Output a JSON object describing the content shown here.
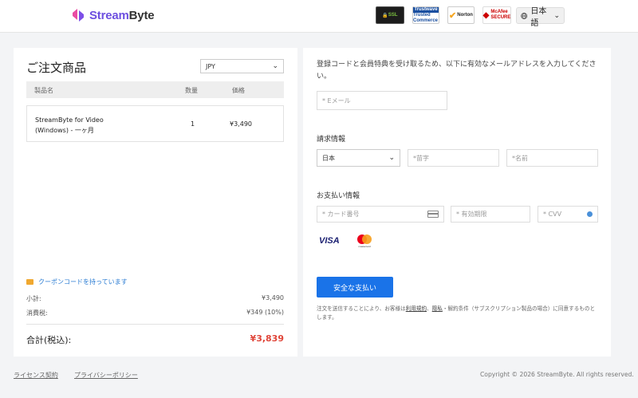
{
  "header": {
    "brand": {
      "prefix": "Stream",
      "suffix": "Byte"
    },
    "badges": {
      "ssl": "SSL",
      "trust_top": "Trustwave",
      "trust_bottom": "Trusted Commerce",
      "norton": "Norton",
      "mcafee": "McAfee SECURE"
    },
    "language": "日本語"
  },
  "order": {
    "title": "ご注文商品",
    "currency": "JPY",
    "columns": {
      "product": "製品名",
      "quantity": "数量",
      "price": "価格"
    },
    "item": {
      "name": "StreamByte for Video (Windows) - 一ヶ月",
      "quantity": "1",
      "price": "¥3,490"
    },
    "coupon_link": "クーポンコードを持っています",
    "subtotal_label": "小計:",
    "subtotal_value": "¥3,490",
    "tax_label": "消費税:",
    "tax_value": "¥349 (10%)",
    "total_label": "合計(税込):",
    "total_value": "¥3,839"
  },
  "form": {
    "intro": "登録コードと会員特典を受け取るため、以下に有効なメールアドレスを入力してください。",
    "email_placeholder": "* Eメール",
    "billing_label": "請求情報",
    "country": "日本",
    "surname_placeholder": "*苗字",
    "given_name_placeholder": "*名前",
    "payment_label": "お支払い情報",
    "card_number_placeholder": "* カード番号",
    "expiry_placeholder": "* 有効期限",
    "cvv_placeholder": "* CVV",
    "visa": "VISA",
    "mastercard": "mastercard",
    "pay_button": "安全な支払い",
    "terms_before": "注文を送信することにより、お客様は",
    "terms_link1": "利用規約",
    "terms_sep": "、",
    "terms_link2": "隠私",
    "terms_after": "・解約条件（サブスクリプション製品の場合）に同意するものとします。"
  },
  "footer": {
    "license": "ライセンス契約",
    "privacy": "プライバシーポリシー",
    "copyright": "Copyright © 2026 StreamByte. All rights reserved."
  },
  "colors": {
    "accent": "#1a73e8",
    "total": "#e0463a",
    "brand": "#6d4fe0",
    "link": "#2b7cd3"
  }
}
